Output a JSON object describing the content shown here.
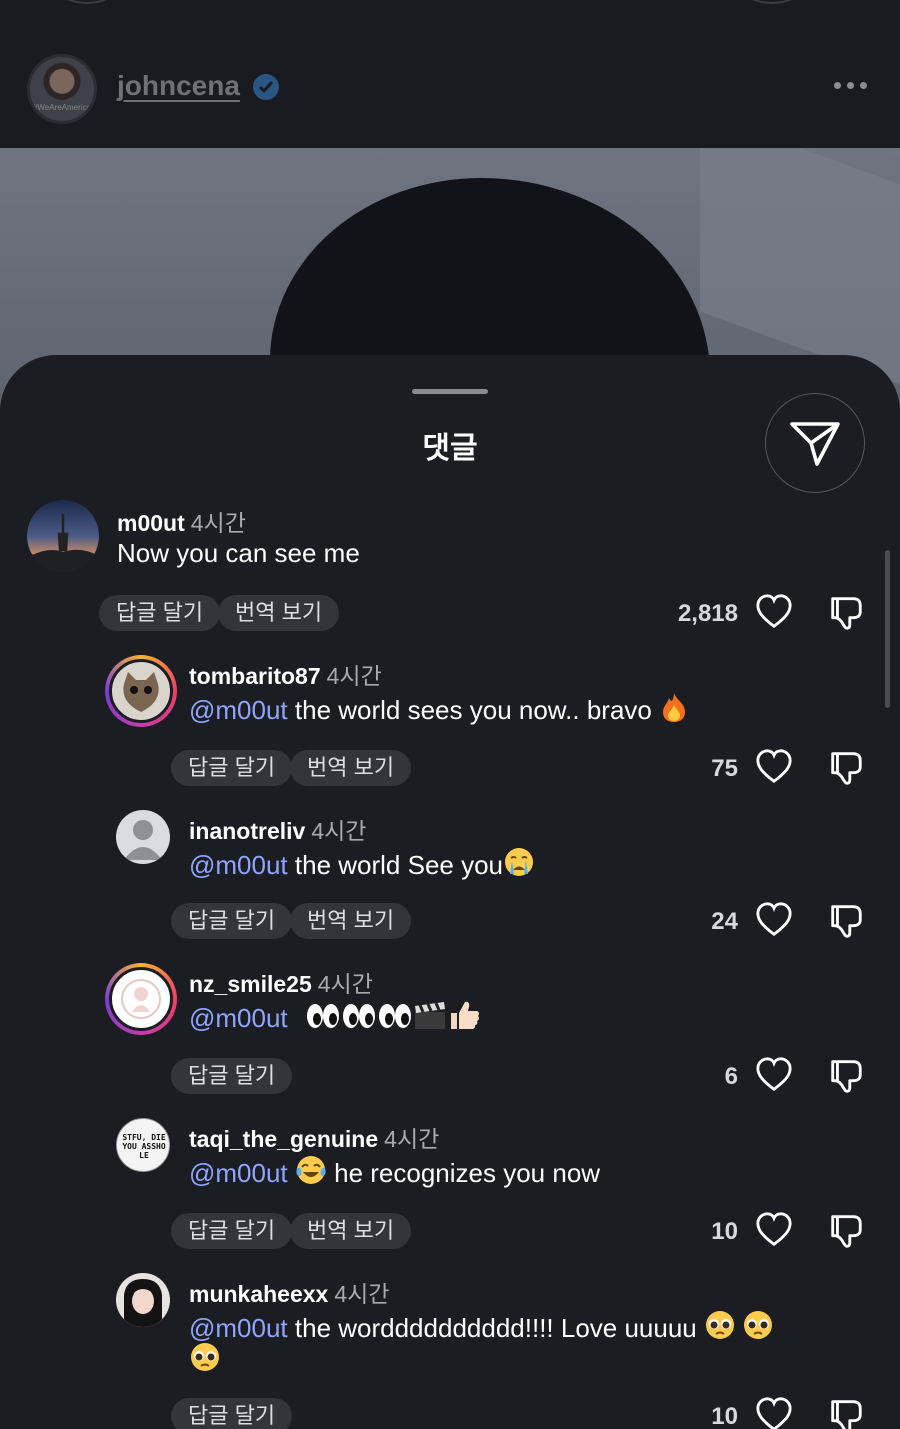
{
  "header": {
    "username": "johncena",
    "avatar_tag": "#WeAreAmerica"
  },
  "sheet": {
    "title": "댓글"
  },
  "comments": [
    {
      "user": "m00ut",
      "time": "4시간",
      "text": "Now you can see me",
      "reply": "답글 달기",
      "translate": "번역 보기",
      "likes": "2,818"
    },
    {
      "user": "tombarito87",
      "time": "4시간",
      "mention": "@m00ut",
      "text": " the world sees you now.. bravo ",
      "reply": "답글 달기",
      "translate": "번역 보기",
      "likes": "75"
    },
    {
      "user": "inanotreliv",
      "time": "4시간",
      "mention": "@m00ut",
      "text": " the world See you",
      "reply": "답글 달기",
      "translate": "번역 보기",
      "likes": "24"
    },
    {
      "user": "nz_smile25",
      "time": "4시간",
      "mention": "@m00ut",
      "text": "",
      "reply": "답글 달기",
      "likes": "6"
    },
    {
      "user": "taqi_the_genuine",
      "time": "4시간",
      "mention": "@m00ut",
      "text": " he recognizes you now",
      "reply": "답글 달기",
      "translate": "번역 보기",
      "likes": "10",
      "avatar_text": "STFU, DIE YOU ASSHOLE"
    },
    {
      "user": "munkaheexx",
      "time": "4시간",
      "mention": "@m00ut",
      "text": " the wordddddddddd!!!! Love uuuuu ",
      "reply": "답글 달기",
      "likes": "10"
    }
  ]
}
